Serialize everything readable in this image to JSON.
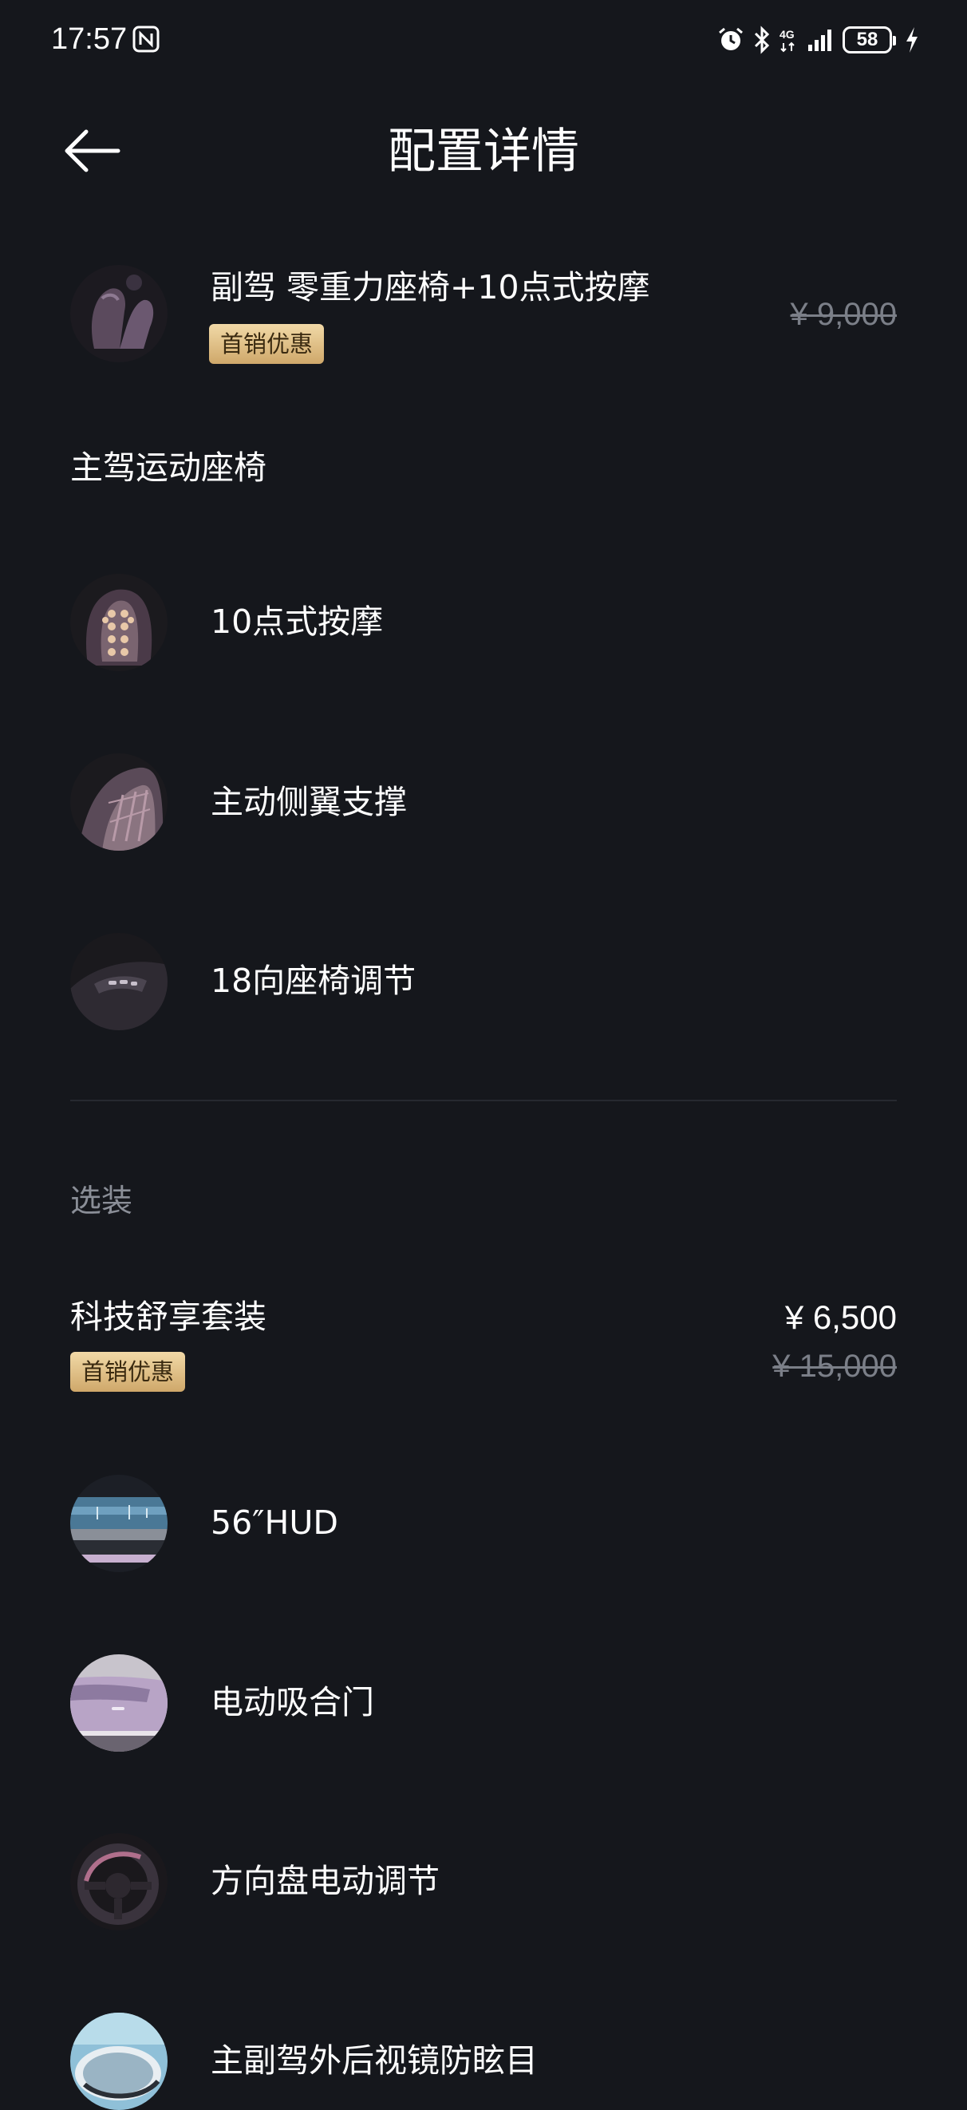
{
  "status_bar": {
    "time": "17:57",
    "battery": "58",
    "icons": [
      "nfc-icon",
      "alarm-icon",
      "bluetooth-icon",
      "4g-icon",
      "signal-icon",
      "battery-icon",
      "charging-icon"
    ]
  },
  "header": {
    "title": "配置详情",
    "back_icon": "arrow-left-icon"
  },
  "passenger_seat": {
    "label": "副驾 零重力座椅+10点式按摩",
    "badge": "首销优惠",
    "original_price": "¥ 9,000"
  },
  "driver_seat": {
    "title": "主驾运动座椅",
    "items": [
      {
        "label": "10点式按摩"
      },
      {
        "label": "主动侧翼支撑"
      },
      {
        "label": "18向座椅调节"
      }
    ]
  },
  "options": {
    "section_title": "选装",
    "package": {
      "name": "科技舒享套装",
      "badge": "首销优惠",
      "price": "¥ 6,500",
      "original_price": "¥ 15,000"
    },
    "items": [
      {
        "label": "56″HUD"
      },
      {
        "label": "电动吸合门"
      },
      {
        "label": "方向盘电动调节"
      },
      {
        "label": "主副驾外后视镜防眩目"
      }
    ]
  },
  "colors": {
    "background": "#15171c",
    "badge_gold": "#d9b77a",
    "muted_text": "#8a8e97"
  }
}
